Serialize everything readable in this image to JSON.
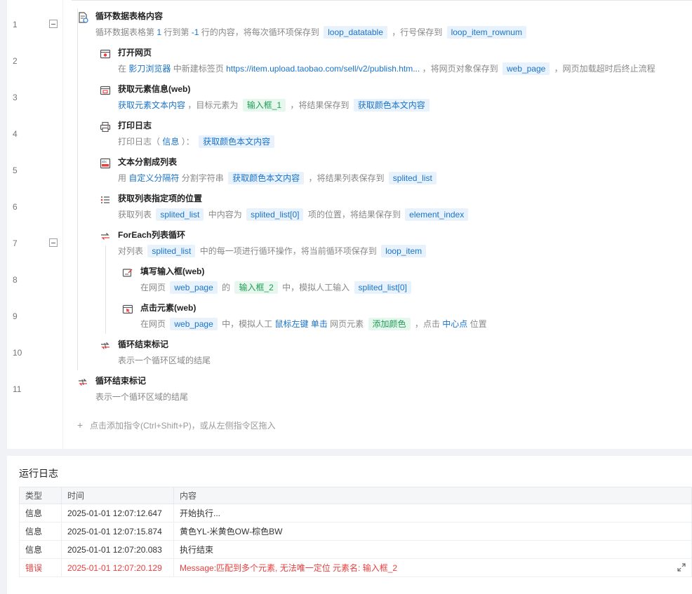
{
  "steps": [
    {
      "line": "1",
      "title": "循环数据表格内容",
      "desc": {
        "t1": "循环数据表格第",
        "n1": "1",
        "t2": "行到第",
        "n2": "-1",
        "t3": "行的内容，将每次循环项保存到",
        "v1": "loop_datatable",
        "t4": "，行号保存到",
        "v2": "loop_item_rownum"
      }
    },
    {
      "line": "2",
      "title": "打开网页",
      "desc": {
        "t1": "在",
        "h1": "影刀浏览器",
        "t2": "中新建标签页",
        "url": "https://item.upload.taobao.com/sell/v2/publish.htm...",
        "t3": "，将网页对象保存到",
        "v1": "web_page",
        "t4": "，网页加载超时后终止流程"
      }
    },
    {
      "line": "3",
      "title": "获取元素信息(web)",
      "desc": {
        "h1": "获取元素文本内容",
        "t1": "，目标元素为",
        "e1": "输入框_1",
        "t2": "，将结果保存到",
        "v1": "获取颜色本文内容"
      }
    },
    {
      "line": "4",
      "title": "打印日志",
      "desc": {
        "t1": "打印日志（",
        "h1": "信息",
        "t2": "）：",
        "v1": "获取颜色本文内容"
      }
    },
    {
      "line": "5",
      "title": "文本分割成列表",
      "desc": {
        "t1": "用",
        "h1": "自定义分隔符",
        "t2": "分割字符串",
        "v1": "获取颜色本文内容",
        "t3": "，将结果列表保存到",
        "v2": "splited_list"
      }
    },
    {
      "line": "6",
      "title": "获取列表指定项的位置",
      "desc": {
        "t1": "获取列表",
        "v1": "splited_list",
        "t2": "中内容为",
        "v2": "splited_list[0]",
        "t3": "项的位置，将结果保存到",
        "v3": "element_index"
      }
    },
    {
      "line": "7",
      "title": "ForEach列表循环",
      "desc": {
        "t1": "对列表",
        "v1": "splited_list",
        "t2": "中的每一项进行循环操作，将当前循环项保存到",
        "v2": "loop_item"
      }
    },
    {
      "line": "8",
      "title": "填写输入框(web)",
      "desc": {
        "t1": "在网页",
        "v1": "web_page",
        "t2": "的",
        "e1": "输入框_2",
        "t3": "中，模拟人工输入",
        "v2": "splited_list[0]"
      }
    },
    {
      "line": "9",
      "title": "点击元素(web)",
      "desc": {
        "t1": "在网页",
        "v1": "web_page",
        "t2": "中，模拟人工",
        "h1": "鼠标左键",
        "h2": "单击",
        "t3": "网页元素",
        "e1": "添加颜色",
        "t4": "，点击",
        "h3": "中心点",
        "t5": "位置"
      }
    },
    {
      "line": "10",
      "title": "循环结束标记",
      "desc": {
        "t1": "表示一个循环区域的结尾"
      }
    },
    {
      "line": "11",
      "title": "循环结束标记",
      "desc": {
        "t1": "表示一个循环区域的结尾"
      }
    }
  ],
  "add_command": "点击添加指令(Ctrl+Shift+P)，或从左侧指令区拖入",
  "log": {
    "title": "运行日志",
    "headers": [
      "类型",
      "时间",
      "内容"
    ],
    "rows": [
      {
        "type": "信息",
        "time": "2025-01-01 12:07:12.647",
        "content": "开始执行..."
      },
      {
        "type": "信息",
        "time": "2025-01-01 12:07:15.874",
        "content": "黄色YL-米黄色OW-棕色BW"
      },
      {
        "type": "信息",
        "time": "2025-01-01 12:07:20.083",
        "content": "执行结束"
      },
      {
        "type": "错误",
        "time": "2025-01-01 12:07:20.129",
        "content": "Message:匹配到多个元素, 无法唯一定位 元素名: 输入框_2"
      }
    ]
  },
  "icons": {
    "step1": "loop-table-icon",
    "step2": "open-webpage-icon",
    "step3": "get-element-info-icon",
    "step4": "print-log-icon",
    "step5": "split-text-icon",
    "step6": "list-index-icon",
    "step7": "foreach-loop-icon",
    "step8": "fill-input-icon",
    "step9": "click-element-icon",
    "step10": "loop-end-icon",
    "step11": "loop-end-icon",
    "expand": "expand-icon",
    "add": "plus-icon"
  }
}
